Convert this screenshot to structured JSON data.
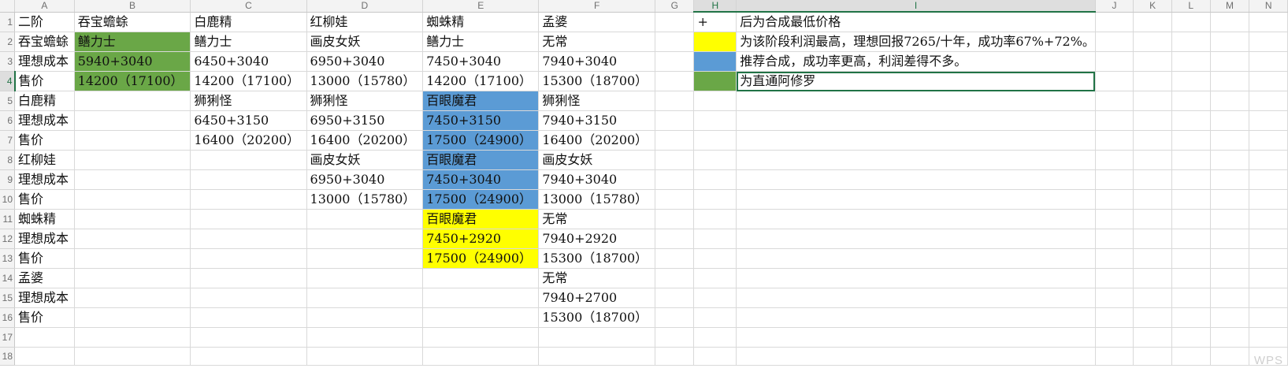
{
  "columns": [
    "A",
    "B",
    "C",
    "D",
    "E",
    "F",
    "G",
    "H",
    "I",
    "J",
    "K",
    "L",
    "M",
    "N"
  ],
  "row_numbers": [
    "1",
    "2",
    "3",
    "4",
    "5",
    "6",
    "7",
    "8",
    "9",
    "10",
    "11",
    "12",
    "13",
    "14",
    "15",
    "16",
    "17",
    "18"
  ],
  "cells": {
    "A1": "二阶",
    "B1": "吞宝蟾蜍",
    "C1": "白鹿精",
    "D1": "红柳娃",
    "E1": "蜘蛛精",
    "F1": "孟婆",
    "H1": "+",
    "I1": "后为合成最低价格",
    "A2": "吞宝蟾蜍",
    "B2": "鳝力士",
    "C2": "鳝力士",
    "D2": "画皮女妖",
    "E2": "鳝力士",
    "F2": "无常",
    "I2": "为该阶段利润最高，理想回报7265/十年，成功率67%+72%。",
    "A3": "理想成本",
    "B3": "5940+3040",
    "C3": "6450+3040",
    "D3": "6950+3040",
    "E3": "7450+3040",
    "F3": "7940+3040",
    "I3": "推荐合成，成功率更高，利润差得不多。",
    "A4": "售价",
    "B4": "14200（17100）",
    "C4": "14200（17100）",
    "D4": "13000（15780）",
    "E4": "14200（17100）",
    "F4": "15300（18700）",
    "I4": "为直通阿修罗",
    "A5": "白鹿精",
    "C5": "狮猁怪",
    "D5": "狮猁怪",
    "E5": "百眼魔君",
    "F5": "狮猁怪",
    "A6": "理想成本",
    "C6": "6450+3150",
    "D6": "6950+3150",
    "E6": "7450+3150",
    "F6": "7940+3150",
    "A7": "售价",
    "C7": "16400（20200）",
    "D7": "16400（20200）",
    "E7": "17500（24900）",
    "F7": "16400（20200）",
    "A8": "红柳娃",
    "D8": "画皮女妖",
    "E8": "百眼魔君",
    "F8": "画皮女妖",
    "A9": "理想成本",
    "D9": "6950+3040",
    "E9": "7450+3040",
    "F9": "7940+3040",
    "A10": "售价",
    "D10": "13000（15780）",
    "E10": "17500（24900）",
    "F10": "13000（15780）",
    "A11": "蜘蛛精",
    "E11": "百眼魔君",
    "F11": "无常",
    "A12": "理想成本",
    "E12": "7450+2920",
    "F12": "7940+2920",
    "A13": "售价",
    "E13": "17500（24900）",
    "F13": "15300（18700）",
    "A14": "孟婆",
    "F14": "无常",
    "A15": "理想成本",
    "F15": "7940+2700",
    "A16": "售价",
    "F16": "15300（18700）"
  },
  "fills": {
    "green": "#6aa747",
    "blue": "#5b9bd5",
    "yellow": "#ffff00",
    "accent": "#217346"
  },
  "watermark": "WPS"
}
